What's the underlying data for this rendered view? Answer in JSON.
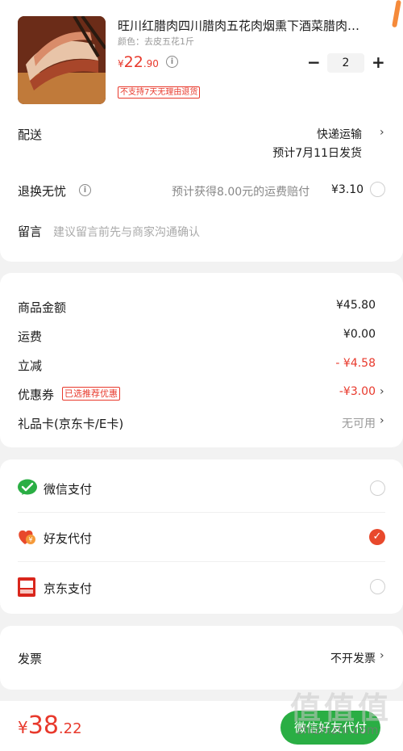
{
  "product": {
    "title": "旺川红腊肉四川腊肉五花肉烟熏下酒菜腊肉…",
    "variant": "颜色：去皮五花1斤",
    "price_symbol": "¥",
    "price_int": "22",
    "price_dec": ".90",
    "return_tag": "不支持7天无理由退货",
    "quantity": "2",
    "minus": "−",
    "plus": "+"
  },
  "delivery": {
    "label": "配送",
    "method": "快递运输",
    "estimate": "预计7月11日发货"
  },
  "return_worry": {
    "label": "退换无忧",
    "desc": "预计获得8.00元的运费赔付",
    "price": "¥3.10"
  },
  "message": {
    "label": "留言",
    "placeholder": "建议留言前先与商家沟通确认"
  },
  "summary": {
    "rows": [
      {
        "label": "商品金额",
        "value": "¥45.80"
      },
      {
        "label": "运费",
        "value": "¥0.00"
      },
      {
        "label": "立减",
        "value": "- ¥4.58"
      },
      {
        "label": "优惠券",
        "tag": "已选推荐优惠",
        "value": "-¥3.00"
      },
      {
        "label": "礼品卡(京东卡/E卡)",
        "value": "无可用"
      }
    ]
  },
  "payment": {
    "options": [
      {
        "label": "微信支付",
        "icon": "wechat-pay-icon",
        "selected": false
      },
      {
        "label": "好友代付",
        "icon": "friend-pay-icon",
        "selected": true
      },
      {
        "label": "京东支付",
        "icon": "jd-pay-icon",
        "selected": false
      }
    ]
  },
  "invoice": {
    "label": "发票",
    "value": "不开发票"
  },
  "footer": {
    "total_symbol": "¥",
    "total_int": "38",
    "total_dec": ".22",
    "pay_button": "微信好友代付"
  },
  "watermark": {
    "text": "值值值",
    "url": "zhizhizhi.com"
  },
  "colors": {
    "accent_red": "#e8392c",
    "wechat_green": "#2aae44",
    "selected_orange": "#e8492c"
  }
}
